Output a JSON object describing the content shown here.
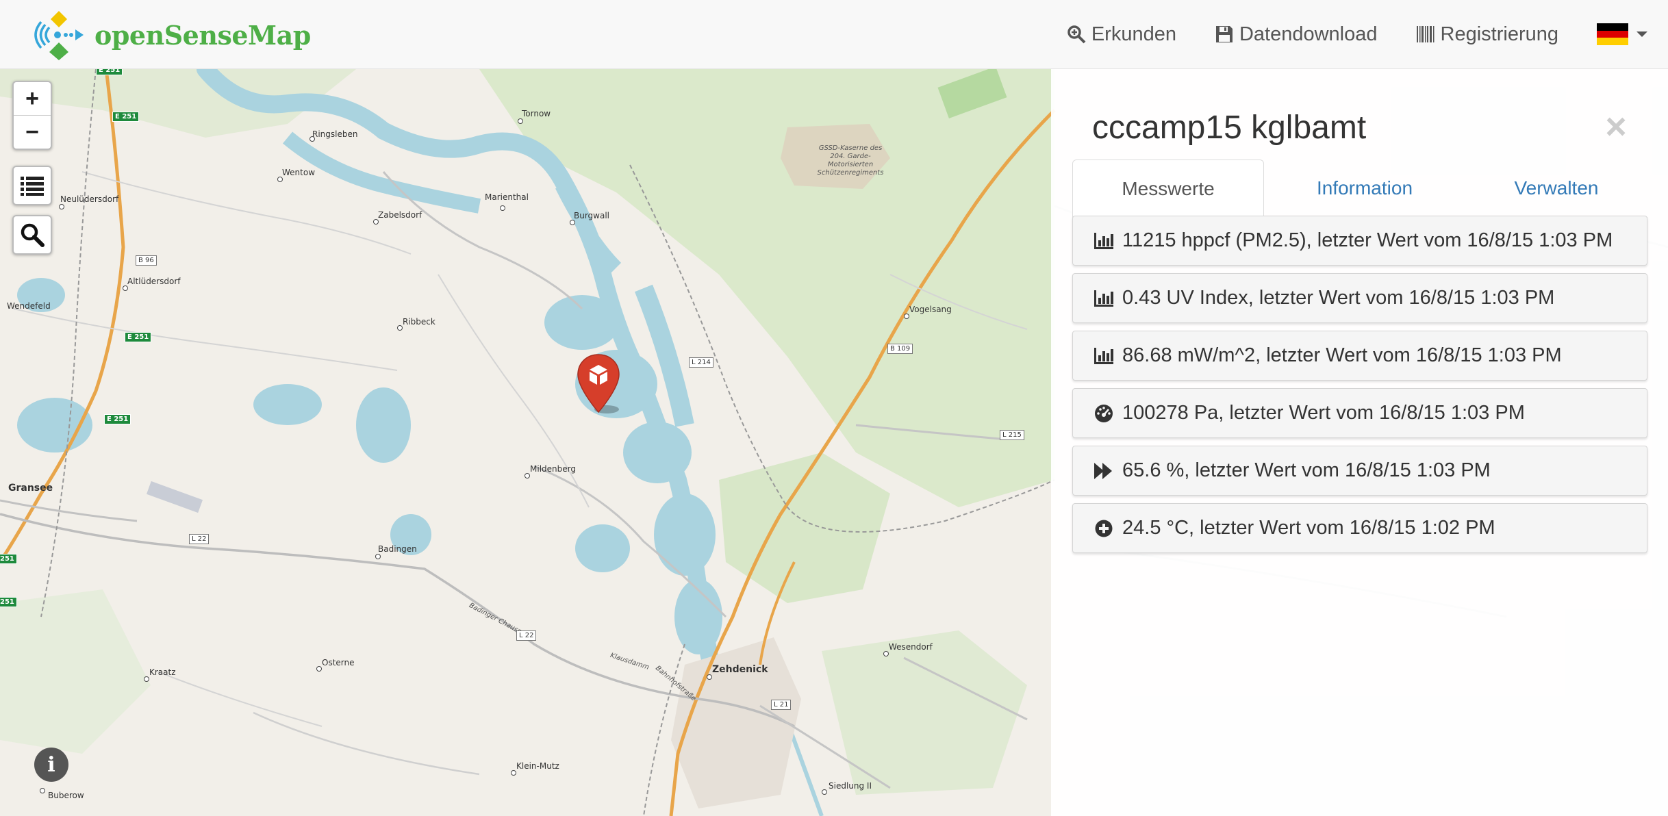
{
  "brand": {
    "name": "openSenseMap"
  },
  "nav": {
    "links": [
      {
        "label": "Erkunden",
        "icon": "search-icon"
      },
      {
        "label": "Datendownload",
        "icon": "floppy-icon"
      },
      {
        "label": "Registrierung",
        "icon": "barcode-icon"
      }
    ],
    "language": {
      "icon": "german-flag-icon",
      "colors": [
        "#000000",
        "#dd0000",
        "#ffce00"
      ]
    }
  },
  "map_controls": {
    "zoom_in": "+",
    "zoom_out": "−",
    "info": "i"
  },
  "map": {
    "places": [
      {
        "name": "Tornow"
      },
      {
        "name": "Ringsleben"
      },
      {
        "name": "Wentow"
      },
      {
        "name": "Neulüdersdorf"
      },
      {
        "name": "Zabelsdorf"
      },
      {
        "name": "Marienthal"
      },
      {
        "name": "Burgwall"
      },
      {
        "name": "Altlüdersdorf"
      },
      {
        "name": "Wendefeld"
      },
      {
        "name": "Ribbeck"
      },
      {
        "name": "Vogelsang"
      },
      {
        "name": "Mildenberg"
      },
      {
        "name": "Gransee"
      },
      {
        "name": "Badingen"
      },
      {
        "name": "Osterne"
      },
      {
        "name": "Kraatz"
      },
      {
        "name": "Zehdenick"
      },
      {
        "name": "Wesendorf"
      },
      {
        "name": "Klein-Mutz"
      },
      {
        "name": "Buberow"
      },
      {
        "name": "Siedlung II"
      }
    ],
    "poi": "GSSD-Kaserne des 204. Garde-Motorisierten Schützenregiments",
    "street_labels": [
      "Badinger Chaussee",
      "Klausdamm",
      "Bahnhofstraße"
    ],
    "roads": [
      "E 251",
      "E 251",
      "E 251",
      "E 251",
      "B 96",
      "L 214",
      "B 109",
      "L 215",
      "L 22",
      "L 22",
      "L 21",
      "251",
      "251"
    ]
  },
  "sidebar": {
    "title": "cccamp15 kglbamt",
    "close": "×",
    "tabs": [
      {
        "label": "Messwerte",
        "active": true
      },
      {
        "label": "Information",
        "active": false
      },
      {
        "label": "Verwalten",
        "active": false
      }
    ],
    "sensors": [
      {
        "icon": "bar-chart-icon",
        "text": "11215 hppcf (PM2.5), letzter Wert vom 16/8/15 1:03 PM"
      },
      {
        "icon": "bar-chart-icon",
        "text": "0.43 UV Index, letzter Wert vom 16/8/15 1:03 PM"
      },
      {
        "icon": "bar-chart-icon",
        "text": "86.68 mW/m^2, letzter Wert vom 16/8/15 1:03 PM"
      },
      {
        "icon": "gauge-icon",
        "text": "100278 Pa, letzter Wert vom 16/8/15 1:03 PM"
      },
      {
        "icon": "fast-forward-icon",
        "text": "65.6 %, letzter Wert vom 16/8/15 1:03 PM"
      },
      {
        "icon": "plus-circle-icon",
        "text": "24.5 °C, letzter Wert vom 16/8/15 1:02 PM"
      }
    ]
  },
  "colors": {
    "brand_green": "#4eaf47",
    "marker_red": "#d63e2a",
    "link_blue": "#337ab7",
    "water": "#aad3df"
  }
}
